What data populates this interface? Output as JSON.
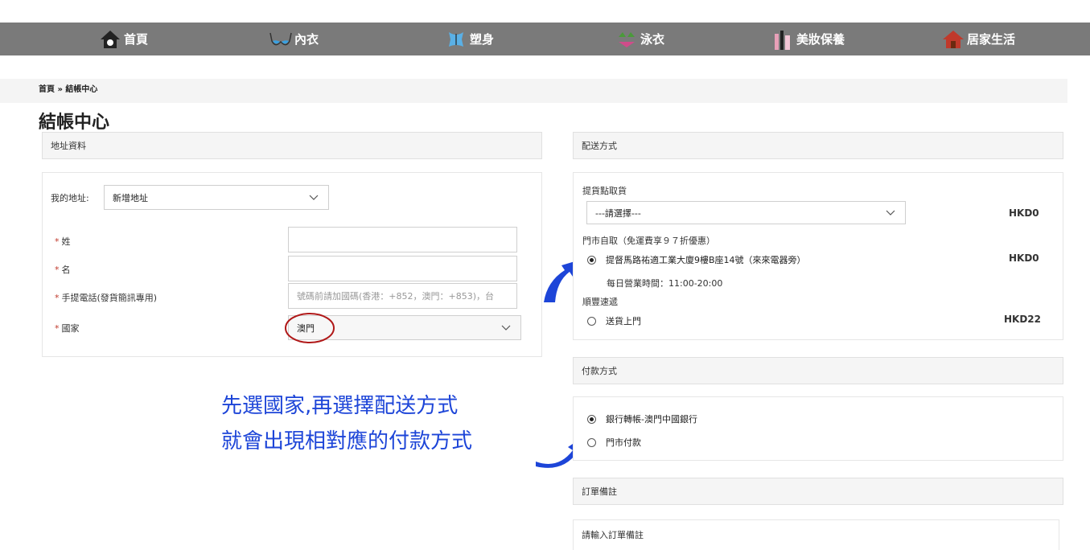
{
  "nav": {
    "items": [
      {
        "label": "首頁",
        "icon": "home-icon"
      },
      {
        "label": "內衣",
        "icon": "bra-icon"
      },
      {
        "label": "塑身",
        "icon": "corset-icon"
      },
      {
        "label": "泳衣",
        "icon": "bikini-icon"
      },
      {
        "label": "美妝保養",
        "icon": "cosmetics-icon"
      },
      {
        "label": "居家生活",
        "icon": "house-icon"
      }
    ]
  },
  "breadcrumb": "首頁 » 結帳中心",
  "page_title": "結帳中心",
  "address": {
    "section_title": "地址資料",
    "my_address_label": "我的地址:",
    "my_address_value": "新增地址",
    "surname_label": "姓",
    "name_label": "名",
    "phone_label": "手提電話(發貨簡訊專用)",
    "phone_placeholder": "號碼前請加國碼(香港：+852，澳門：+853)，台",
    "country_label": "國家",
    "country_value": "澳門",
    "required_mark": "*"
  },
  "shipping": {
    "section_title": "配送方式",
    "pickup_title": "提貨點取貨",
    "pickup_select": "---請選擇---",
    "pickup_price": "HKD0",
    "store_title": "門市自取（免運費享９７折優惠）",
    "store_option": "提督馬路祐適工業大廈9樓B座14號（來來電器旁）",
    "store_price": "HKD0",
    "store_hours": "每日營業時間：11:00-20:00",
    "sf_title": "順豐速遞",
    "sf_option": "送貨上門",
    "sf_price": "HKD22"
  },
  "payment": {
    "section_title": "付款方式",
    "option1": "銀行轉帳-澳門中國銀行",
    "option2": "門市付款"
  },
  "order_note": {
    "section_title": "訂單備註",
    "placeholder": "請輸入訂單備註"
  },
  "annotation": {
    "line1": "先選國家,再選擇配送方式",
    "line2": "就會出現相對應的付款方式"
  },
  "colors": {
    "nav_bg": "#7a7a7a",
    "annotation_blue": "#1d45d8",
    "circle_red": "#b01818",
    "required_red": "#c0392b"
  }
}
